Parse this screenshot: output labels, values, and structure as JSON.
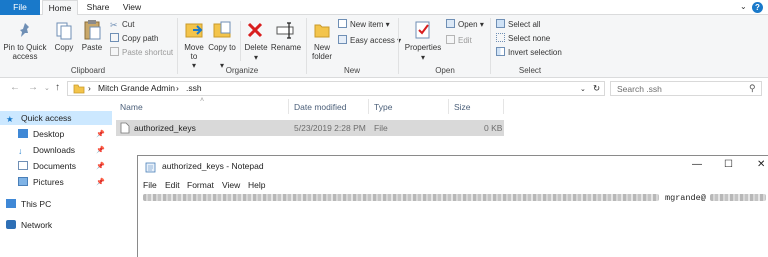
{
  "ribbon_tabs": {
    "file": "File",
    "home": "Home",
    "share": "Share",
    "view": "View"
  },
  "clipboard": {
    "pin_label": "Pin to Quick access",
    "copy_label": "Copy",
    "paste_label": "Paste",
    "cut_label": "Cut",
    "copy_path_label": "Copy path",
    "paste_shortcut_label": "Paste shortcut",
    "group_label": "Clipboard"
  },
  "organize": {
    "move_to_label": "Move to",
    "copy_to_label": "Copy to",
    "delete_label": "Delete",
    "rename_label": "Rename",
    "group_label": "Organize"
  },
  "new": {
    "new_folder_label": "New folder",
    "new_item_label": "New item",
    "easy_access_label": "Easy access",
    "group_label": "New"
  },
  "open": {
    "properties_label": "Properties",
    "open_label": "Open",
    "edit_label": "Edit",
    "group_label": "Open"
  },
  "select": {
    "select_all_label": "Select all",
    "select_none_label": "Select none",
    "invert_label": "Invert selection",
    "group_label": "Select"
  },
  "address": {
    "crumbs": [
      "Mitch Grande Admin",
      ".ssh"
    ],
    "separator": "›",
    "search_placeholder": "Search .ssh"
  },
  "nav_pane": [
    {
      "label": "Quick access",
      "pinned": false
    },
    {
      "label": "Desktop",
      "pinned": true
    },
    {
      "label": "Downloads",
      "pinned": true
    },
    {
      "label": "Documents",
      "pinned": true
    },
    {
      "label": "Pictures",
      "pinned": true
    },
    {
      "label": "This PC",
      "pinned": false
    },
    {
      "label": "Network",
      "pinned": false
    }
  ],
  "file_list": {
    "columns": [
      "Name",
      "Date modified",
      "Type",
      "Size"
    ],
    "rows": [
      {
        "name": "authorized_keys",
        "date": "5/23/2019 2:28 PM",
        "type": "File",
        "size": "0 KB"
      }
    ]
  },
  "notepad": {
    "title": "authorized_keys - Notepad",
    "menu": [
      "File",
      "Edit",
      "Format",
      "View",
      "Help"
    ],
    "visible_text": "mgrande@"
  },
  "colors": {
    "accent": "#1979ca",
    "selection": "#cce8ff",
    "row_selected": "#d9d9d9"
  }
}
